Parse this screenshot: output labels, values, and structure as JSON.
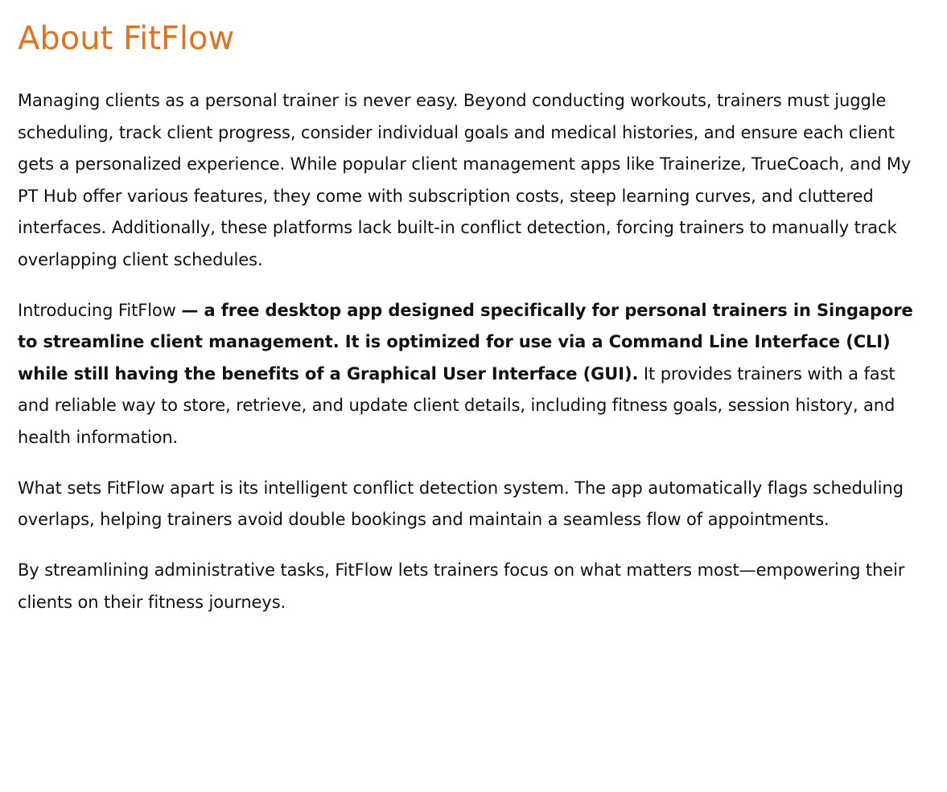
{
  "page": {
    "title": "About FitFlow",
    "paragraphs": {
      "p1": "Managing clients as a personal trainer is never easy. Beyond conducting workouts, trainers must juggle scheduling, track client progress, consider individual goals and medical histories, and ensure each client gets a personalized experience. While popular client management apps like Trainerize, TrueCoach, and My PT Hub offer various features, they come with subscription costs, steep learning curves, and cluttered interfaces. Additionally, these platforms lack built-in conflict detection, forcing trainers to manually track overlapping client schedules.",
      "p2_intro": "Introducing FitFlow ",
      "p2_bold": "— a free desktop app designed specifically for personal trainers in Singapore to streamline client management. It is optimized for use via a Command Line Interface (CLI) while still having the benefits of a Graphical User Interface (GUI).",
      "p2_rest": " It provides trainers with a fast and reliable way to store, retrieve, and update client details, including fitness goals, session history, and health information.",
      "p3": "What sets FitFlow apart is its intelligent conflict detection system. The app automatically flags scheduling overlaps, helping trainers avoid double bookings and maintain a seamless flow of appointments.",
      "p4": "By streamlining administrative tasks, FitFlow lets trainers focus on what matters most—empowering their clients on their fitness journeys."
    }
  },
  "colors": {
    "title": "#e3731d",
    "text": "#111111",
    "background": "#ffffff"
  }
}
